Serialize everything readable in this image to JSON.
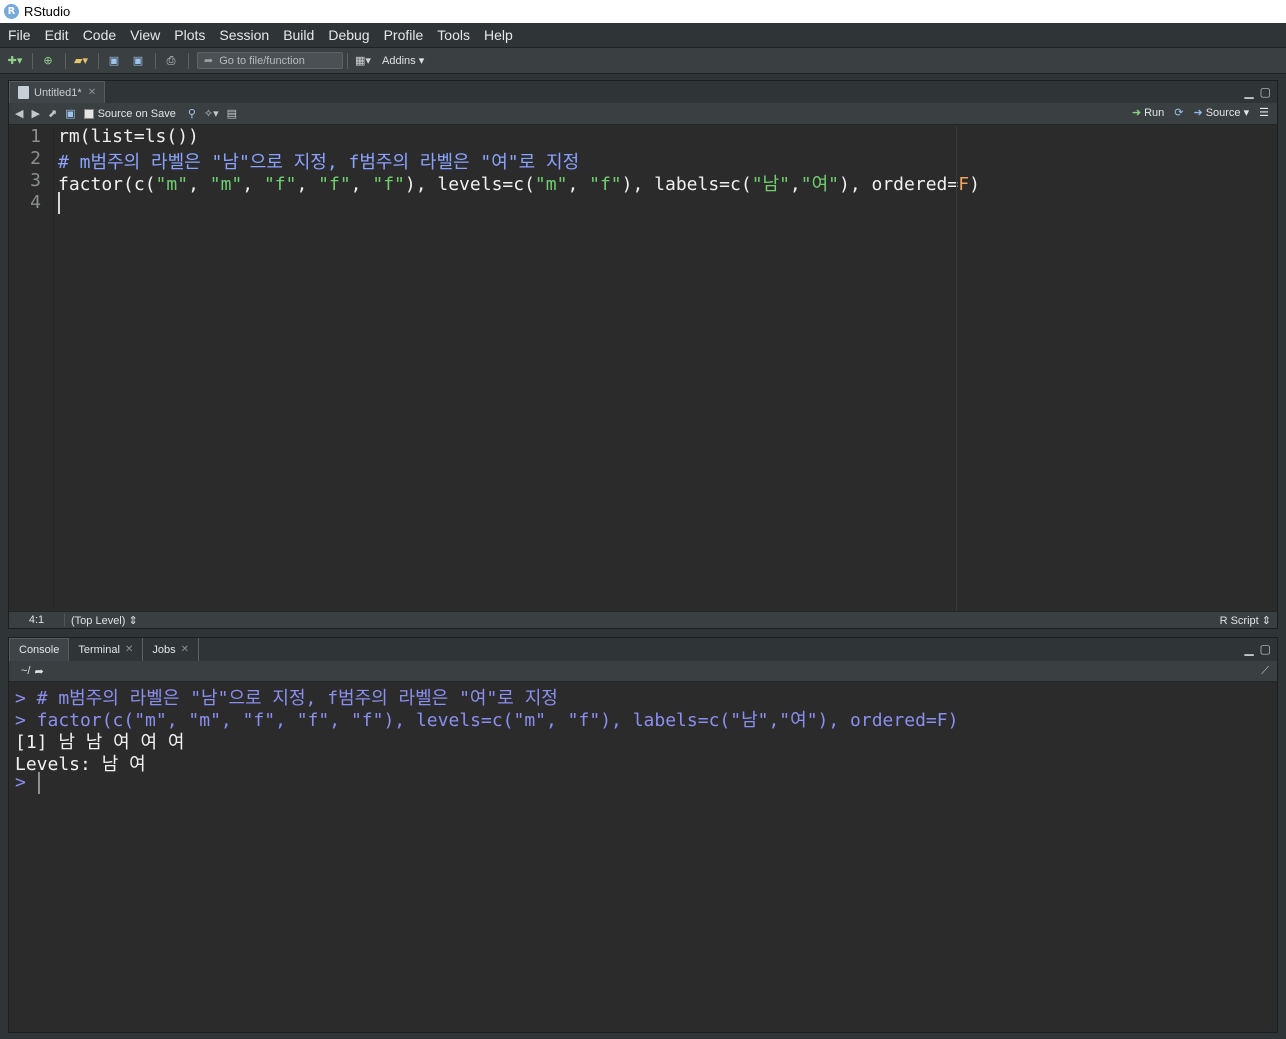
{
  "window": {
    "title": "RStudio"
  },
  "menu": [
    "File",
    "Edit",
    "Code",
    "View",
    "Plots",
    "Session",
    "Build",
    "Debug",
    "Profile",
    "Tools",
    "Help"
  ],
  "toolbar": {
    "goto_placeholder": "Go to file/function",
    "addins_label": "Addins"
  },
  "source": {
    "tab_label": "Untitled1*",
    "source_on_save": "Source on Save",
    "run_label": "Run",
    "source_label": "Source",
    "line_numbers": [
      "1",
      "2",
      "3",
      "4"
    ],
    "code": [
      [
        {
          "t": "rm(list=ls())",
          "c": "c-norm"
        }
      ],
      [
        {
          "t": "# m범주의 라벨은 \"남\"으로 지정, f범주의 라벨은 \"여\"로 지정",
          "c": "c-comment"
        }
      ],
      [
        {
          "t": "factor(c(",
          "c": "c-norm"
        },
        {
          "t": "\"m\"",
          "c": "c-str"
        },
        {
          "t": ", ",
          "c": "c-norm"
        },
        {
          "t": "\"m\"",
          "c": "c-str"
        },
        {
          "t": ", ",
          "c": "c-norm"
        },
        {
          "t": "\"f\"",
          "c": "c-str"
        },
        {
          "t": ", ",
          "c": "c-norm"
        },
        {
          "t": "\"f\"",
          "c": "c-str"
        },
        {
          "t": ", ",
          "c": "c-norm"
        },
        {
          "t": "\"f\"",
          "c": "c-str"
        },
        {
          "t": "), levels=c(",
          "c": "c-norm"
        },
        {
          "t": "\"m\"",
          "c": "c-str"
        },
        {
          "t": ", ",
          "c": "c-norm"
        },
        {
          "t": "\"f\"",
          "c": "c-str"
        },
        {
          "t": "), labels=c(",
          "c": "c-norm"
        },
        {
          "t": "\"남\"",
          "c": "c-str"
        },
        {
          "t": ",",
          "c": "c-norm"
        },
        {
          "t": "\"여\"",
          "c": "c-str"
        },
        {
          "t": "), ordered=",
          "c": "c-norm"
        },
        {
          "t": "F",
          "c": "c-const"
        },
        {
          "t": ")",
          "c": "c-norm"
        }
      ],
      [
        {
          "t": "",
          "c": "c-norm"
        }
      ]
    ],
    "status_position": "4:1",
    "status_scope": "(Top Level)",
    "status_filetype": "R Script"
  },
  "console": {
    "tabs": [
      "Console",
      "Terminal",
      "Jobs"
    ],
    "path": "~/",
    "lines": [
      {
        "t": "> # m범주의 라벨은 \"남\"으로 지정, f범주의 라벨은 \"여\"로 지정",
        "c": "p-in"
      },
      {
        "t": "> factor(c(\"m\", \"m\", \"f\", \"f\", \"f\"), levels=c(\"m\", \"f\"), labels=c(\"남\",\"여\"), ordered=F)",
        "c": "p-in"
      },
      {
        "t": "[1] 남 남 여 여 여",
        "c": "p-out"
      },
      {
        "t": "Levels: 남 여",
        "c": "p-out"
      },
      {
        "t": "> ",
        "c": "p-in"
      }
    ]
  }
}
